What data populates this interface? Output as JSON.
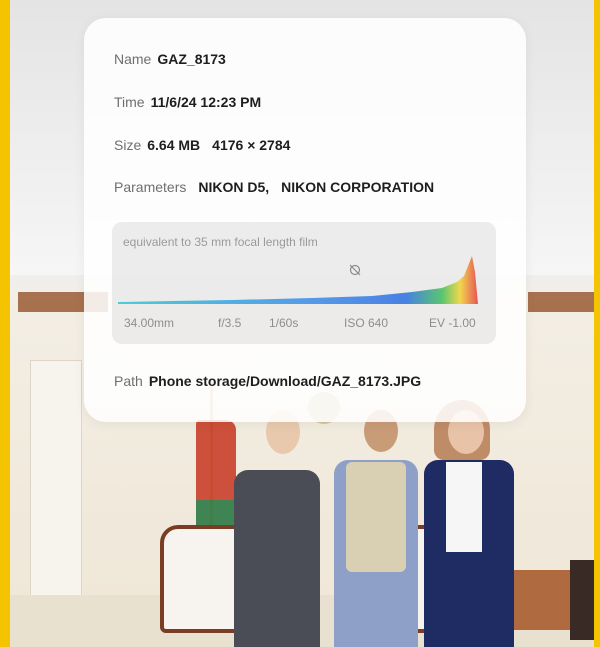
{
  "info_panel": {
    "name": {
      "label": "Name",
      "value": "GAZ_8173"
    },
    "time": {
      "label": "Time",
      "value": "11/6/24 12:23 PM"
    },
    "size": {
      "label": "Size",
      "file_size": "6.64 MB",
      "dimensions": "4176 × 2784"
    },
    "parameters": {
      "label": "Parameters",
      "camera_model": "NIKON D5,",
      "maker": "NIKON CORPORATION"
    },
    "histogram": {
      "caption": "equivalent to 35 mm focal length film",
      "caption_icon": "crossed-out-aperture-icon",
      "exif": {
        "focal_length": "34.00mm",
        "aperture": "f/3.5",
        "shutter": "1/60s",
        "iso": "ISO 640",
        "exposure": "EV -1.00"
      },
      "colors": {
        "blue": "#2b6fe0",
        "cyan": "#2fc6d6",
        "green": "#3fbf5a",
        "yellow": "#f2d330",
        "red": "#e63b3b"
      }
    },
    "path": {
      "label": "Path",
      "value": "Phone storage/Download/GAZ_8173.JPG"
    }
  },
  "frame_color": "#f5c400"
}
